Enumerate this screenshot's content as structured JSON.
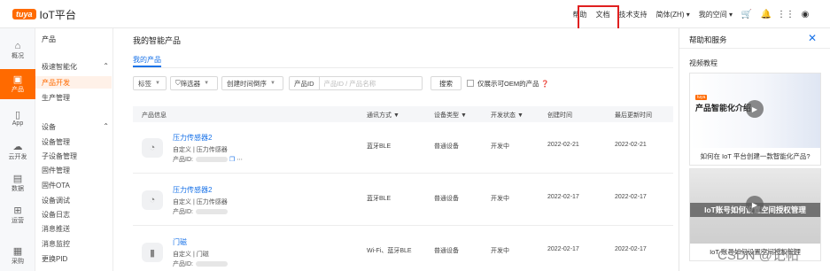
{
  "topbar": {
    "logo_badge": "tuya",
    "logo_text": "IoT平台",
    "nav": [
      "帮助",
      "文档",
      "技术支持",
      "简体(ZH)",
      "我的空间"
    ],
    "icons": [
      "cart-icon",
      "bell-icon",
      "apps-grid-icon",
      "user-icon"
    ],
    "highlight_color": "#e02020"
  },
  "rail": {
    "items": [
      {
        "label": "概况",
        "icon": "home-icon"
      },
      {
        "label": "产品",
        "icon": "product-icon",
        "active": true
      },
      {
        "label": "App",
        "icon": "phone-icon"
      },
      {
        "label": "云开发",
        "icon": "cloud-icon"
      },
      {
        "label": "数据",
        "icon": "chart-icon"
      },
      {
        "label": "运营",
        "icon": "ops-icon"
      },
      {
        "label": "采购",
        "icon": "cart-icon"
      }
    ]
  },
  "menu": {
    "head": "产品",
    "group1": "极速智能化",
    "group1_items": [
      "产品开发",
      "生产管理"
    ],
    "group2": "设备",
    "group2_items": [
      "设备管理",
      "子设备管理",
      "固件管理",
      "固件OTA",
      "设备调试",
      "设备日志",
      "消息推送",
      "消息监控",
      "更换PID"
    ]
  },
  "main": {
    "title": "我的智能产品",
    "tab": "我的产品",
    "filters": {
      "tag": "标签",
      "filter": "筛选器",
      "sort": "创建时间倒序",
      "pid_label": "产品ID",
      "pid_placeholder": "产品ID / 产品名称",
      "search": "搜索",
      "oem_label": "仅展示可OEM的产品"
    },
    "columns": [
      "产品信息",
      "通讯方式",
      "设备类型",
      "开发状态",
      "创建时间",
      "最后更新时间"
    ],
    "rows": [
      {
        "name": "压力传感器2",
        "meta": "自定义 | 压力传感器",
        "pid_label": "产品ID:",
        "comm": "蓝牙BLE",
        "type": "普通设备",
        "status": "开发中",
        "created": "2022-02-21",
        "updated": "2022-02-21"
      },
      {
        "name": "压力传感器2",
        "meta": "自定义 | 压力传感器",
        "pid_label": "产品ID:",
        "comm": "蓝牙BLE",
        "type": "普通设备",
        "status": "开发中",
        "created": "2022-02-17",
        "updated": "2022-02-17"
      },
      {
        "name": "门磁",
        "meta": "自定义 | 门磁",
        "pid_label": "产品ID:",
        "comm": "Wi-Fi、蓝牙BLE",
        "type": "普通设备",
        "status": "开发中",
        "created": "2022-02-17",
        "updated": "2022-02-17"
      }
    ]
  },
  "help": {
    "title": "帮助和服务",
    "section": "视频教程",
    "card1": {
      "heading": "产品智能化介绍",
      "badge": "tuya",
      "caption": "如何在 IoT 平台创建一款智能化产品?"
    },
    "card2": {
      "heading": "IoT账号如何设置空间授权管理",
      "caption": "IoT 账号如何设置空间授权管理"
    }
  },
  "watermark": "CSDN @记帖"
}
